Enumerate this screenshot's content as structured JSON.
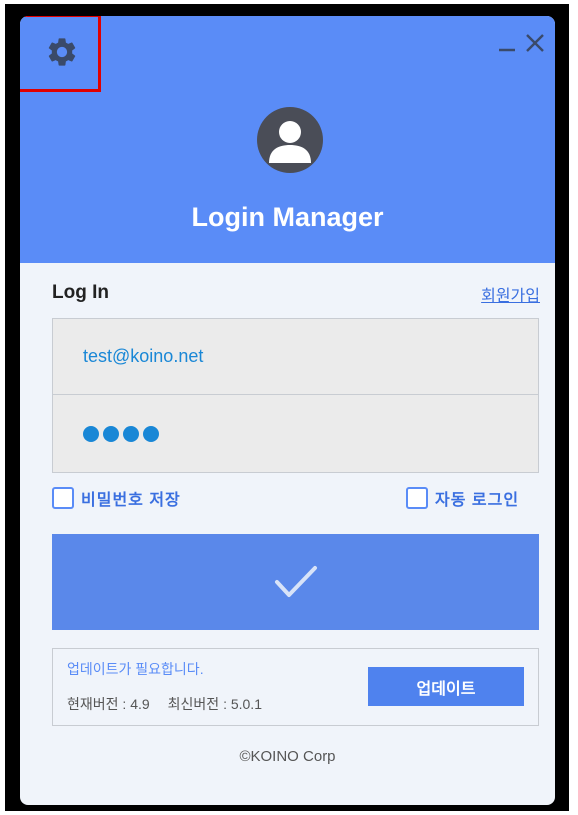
{
  "header": {
    "title": "Login Manager",
    "settings_icon": "gear-icon",
    "minimize_icon": "minimize-icon",
    "close_icon": "close-icon",
    "avatar_icon": "user-avatar-icon"
  },
  "form": {
    "section_label": "Log In",
    "signup_link": "회원가입",
    "email_value": "test@koino.net",
    "password_value": "●●●●",
    "save_password_label": "비밀번호 저장",
    "auto_login_label": "자동 로그인",
    "save_password_checked": false,
    "auto_login_checked": false,
    "login_icon": "checkmark-icon"
  },
  "update": {
    "message": "업데이트가 필요합니다.",
    "current_version_label": "현재버전 : 4.9",
    "latest_version_label": "최신버전 : 5.0.1",
    "button_label": "업데이트"
  },
  "footer": {
    "copyright": "©KOINO Corp"
  },
  "colors": {
    "header_bg": "#5a8cf7",
    "button_bg": "#5a88ea",
    "text_blue": "#1987d6",
    "highlight": "#e00000"
  }
}
